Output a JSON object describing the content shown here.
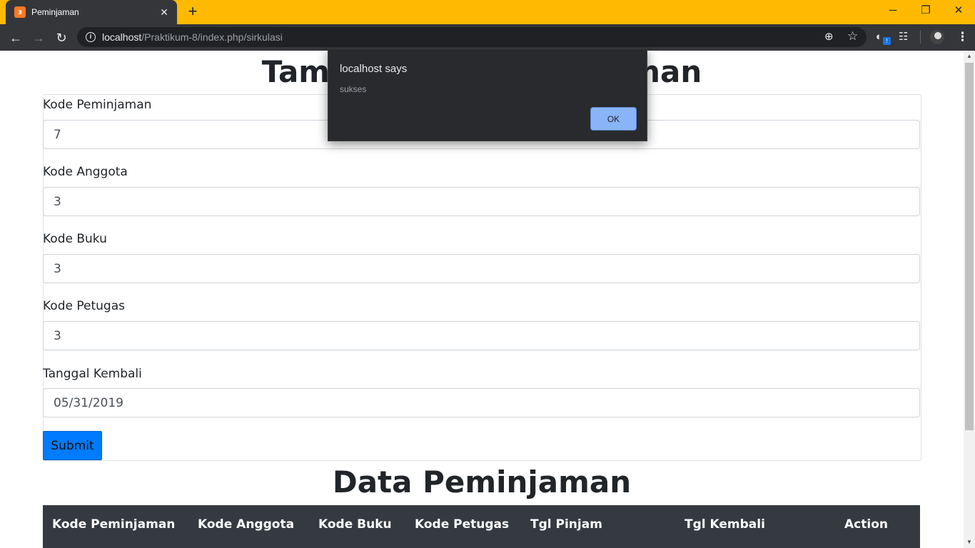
{
  "browser": {
    "tab_title": "Peminjaman",
    "tab_favicon": "xampp-icon",
    "url_host": "localhost",
    "url_path": "/Praktikum-8/index.php/sirkulasi",
    "window_controls": {
      "minimize": "─",
      "restore": "❐",
      "close": "✕"
    },
    "new_tab": "+",
    "close_tab": "✕"
  },
  "page": {
    "title": "Tambah Data Peminjaman",
    "fields": [
      {
        "label": "Kode Peminjaman",
        "value": "7"
      },
      {
        "label": "Kode Anggota",
        "value": "3"
      },
      {
        "label": "Kode Buku",
        "value": "3"
      },
      {
        "label": "Kode Petugas",
        "value": "3"
      },
      {
        "label": "Tanggal Kembali",
        "value": "05/31/2019"
      }
    ],
    "submit_label": "Submit",
    "table_title": "Data Peminjaman",
    "table_columns": [
      "Kode Peminjaman",
      "Kode Anggota",
      "Kode Buku",
      "Kode Petugas",
      "Tgl Pinjam",
      "Tgl Kembali",
      "Action"
    ]
  },
  "dialog": {
    "title": "localhost says",
    "message": "sukses",
    "ok_label": "OK"
  },
  "colors": {
    "titlebar": "#ffb900",
    "toolbar": "#35363a",
    "submit": "#007bff",
    "table_head": "#343a40",
    "dialog_bg": "#292a2d",
    "dialog_ok": "#8ab4f8"
  }
}
